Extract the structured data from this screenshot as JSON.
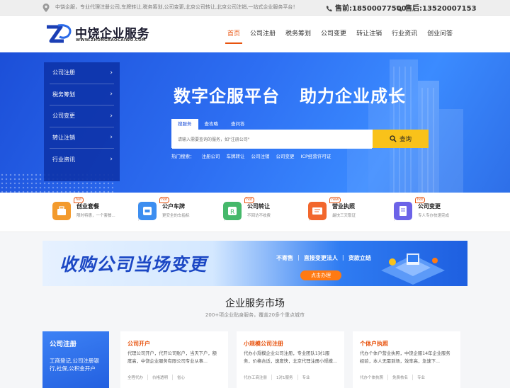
{
  "topbar": {
    "tagline": "中饶企服，专业代理注册公司,车牌转让,税务筹划,公司变更,北京公司转让,北京公司注销,一站式企业服务平台！",
    "phone_pre": "售前:18500077500",
    "phone_post": "售后:13520007153"
  },
  "header": {
    "brand": "中饶企业服务",
    "url": "WWW.ZHONGRAOCAIWU.COM",
    "nav": [
      "首页",
      "公司注册",
      "税务筹划",
      "公司变更",
      "转让注销",
      "行业资讯",
      "创业问答"
    ]
  },
  "hero": {
    "sidemenu": [
      "公司注册",
      "税务筹划",
      "公司变更",
      "转让注销",
      "行业资讯"
    ],
    "title_left": "数字企服平台",
    "title_right": "助力企业成长",
    "search_tabs": [
      "搜服务",
      "查攻略",
      "查问答"
    ],
    "search_placeholder": "请输入需要查询的服务，如\"注册公司\"",
    "search_button": "查询",
    "hot_label": "热门搜索：",
    "hot_keywords": [
      "注册公司",
      "车牌转让",
      "公司注销",
      "公司变更",
      "ICP经营许可证"
    ]
  },
  "services": [
    {
      "name": "创业套餐",
      "desc": "限时特惠，一个套餐...",
      "badge": "hot",
      "color": "#f39a2c"
    },
    {
      "name": "公户车牌",
      "desc": "更安全的车指标",
      "badge": "hot",
      "color": "#3d8ef0"
    },
    {
      "name": "公司转让",
      "desc": "不回访不收费",
      "badge": "hot",
      "color": "#45b86a"
    },
    {
      "name": "营业执照",
      "desc": "最快三天取证",
      "badge": "new",
      "color": "#f2672d"
    },
    {
      "name": "公司变更",
      "desc": "专人专办快速完成",
      "badge": "hot",
      "color": "#6c63e8"
    }
  ],
  "banner": {
    "headline": "收购公司当场变更",
    "tags": [
      "不寄售",
      "|",
      "直接变更法人",
      "|",
      "货款立结"
    ],
    "cta": "点击办理"
  },
  "market": {
    "title": "企业服务市场",
    "subtitle": "200+项企业贴身服务，覆盖20多个重点城市",
    "blue_card": {
      "title": "公司注册",
      "desc": "工商登记,公司注册银行,社保,公积金开户"
    },
    "cards": [
      {
        "title": "公司开户",
        "desc": "代理公司开户，代开公司账户，当天下户，额度高，中饶企业服务有限公司专业从事...",
        "tags": [
          "全程代办",
          "价格透明",
          "省心"
        ]
      },
      {
        "title": "小规模公司注册",
        "desc": "代办小规模企业公司注册，专业团队1对1服务，价格合适，速度快，北京代理注册小规模...",
        "tags": [
          "代办工商注册",
          "1对1服务",
          "专业"
        ]
      },
      {
        "title": "个体户执照",
        "desc": "代办个体户营业执照，中饶企服14年企业服务经验，本人无需到场，效率高，急速下...",
        "tags": [
          "代办个体执照",
          "免费核名",
          "专业"
        ]
      }
    ]
  },
  "colors": {
    "accent": "#e8530e",
    "primary": "#2d6ef2",
    "button": "#f9c21a"
  }
}
